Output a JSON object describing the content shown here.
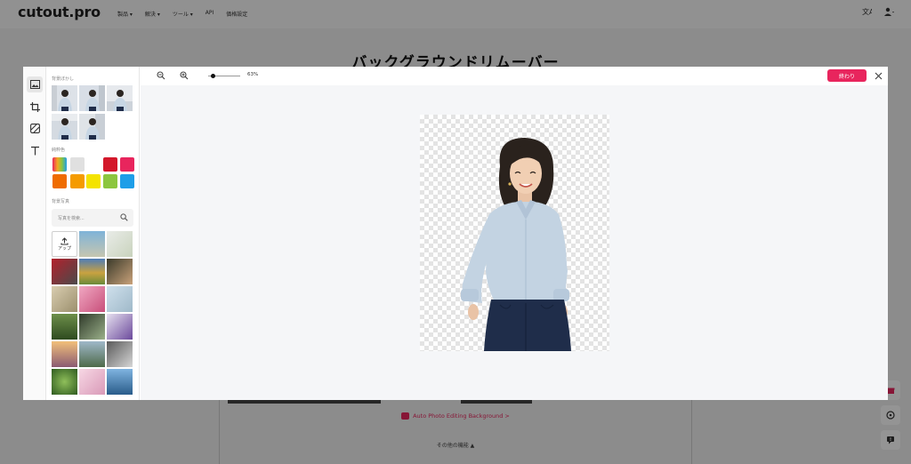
{
  "brand": {
    "logo": "cutout.pro",
    "accent": "#e8255d"
  },
  "nav": {
    "items": [
      "製品 ▾",
      "解決 ▾",
      "ツール ▾",
      "API",
      "価格設定"
    ],
    "translate_icon": "translate-icon",
    "user_icon": "user-icon"
  },
  "page": {
    "title": "バックグラウンドリムーバー",
    "auto_link": "Auto Photo Editing Background >",
    "more_label": "その他の機能 ▲"
  },
  "editor": {
    "zoom_percent": "63%",
    "done_label": "終わり",
    "tools": [
      "background-icon",
      "crop-icon",
      "erase-restore-icon",
      "text-icon"
    ],
    "sections": {
      "presets_label": "背景ぼかし",
      "colors_label": "純粋色",
      "photos_label": "背景写真"
    },
    "search_placeholder": "写真を検索...",
    "upload_label": "アップ",
    "colors": [
      "#e0e0e0",
      "#d3182b",
      "#e8255d",
      "#ef6c00",
      "#f59b00",
      "#f4e300",
      "#8cc63f",
      "#1e9ee8"
    ]
  }
}
